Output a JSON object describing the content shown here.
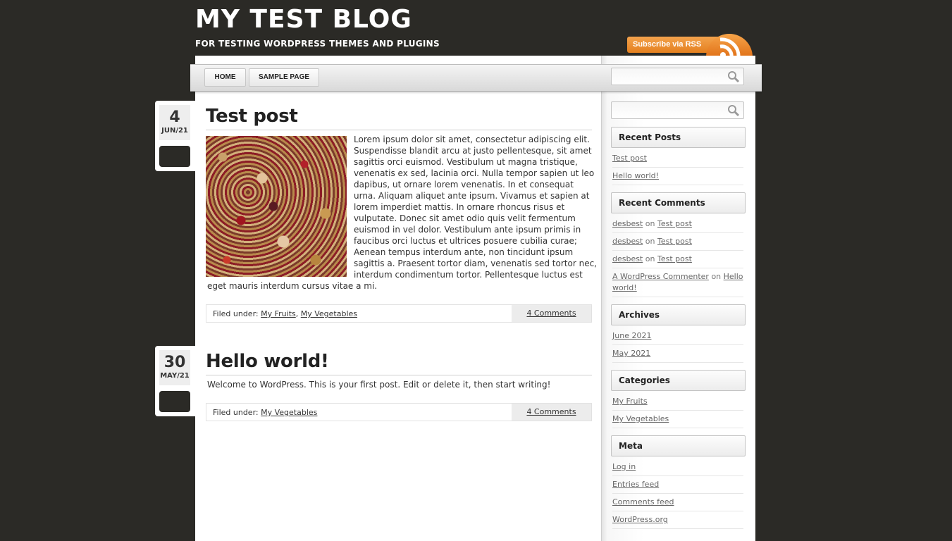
{
  "site": {
    "title": "MY TEST BLOG",
    "tagline": "FOR TESTING WORDPRESS THEMES AND PLUGINS",
    "rss_label": "Subscribe via RSS"
  },
  "nav": {
    "tabs": [
      {
        "label": "HOME"
      },
      {
        "label": "SAMPLE PAGE"
      }
    ],
    "search_placeholder": ""
  },
  "posts": [
    {
      "day": "4",
      "month": "JUN/21",
      "title": "Test post",
      "lines": [
        "Lorem ipsum dolor sit amet, consectetur adipiscing elit.",
        "Suspendisse blandit arcu at justo pellentesque, sit amet",
        "sagittis orci euismod. Vestibulum ut magna tristique,",
        "venenatis ex sed, lacinia orci. Nulla tempor sapien ut leo",
        "dapibus, ut ornare lorem venenatis. In et consequat",
        "urna. Aliquam aliquet ante ipsum. Vivamus et sapien at",
        "lorem imperdiet mattis. In ornare rhoncus risus et",
        "vulputate. Donec sit amet odio quis velit fermentum",
        "euismod in vel dolor. Vestibulum ante ipsum primis in",
        "faucibus orci luctus et ultrices posuere cubilia curae;",
        "Aenean tempus interdum ante, non tincidunt ipsum",
        "sagittis a. Praesent tortor diam, venenatis sed tortor nec,",
        "interdum condimentum tortor. Pellentesque luctus est"
      ],
      "last_line": "eget mauris interdum cursus vitae a mi.",
      "filed_label": "Filed under:",
      "categories": [
        "My Fruits",
        "My Vegetables"
      ],
      "comments": "4 Comments"
    },
    {
      "day": "30",
      "month": "MAY/21",
      "title": "Hello world!",
      "body": "Welcome to WordPress. This is your first post. Edit or delete it, then start writing!",
      "filed_label": "Filed under:",
      "categories": [
        "My Vegetables"
      ],
      "comments": "4 Comments"
    }
  ],
  "sidebar": {
    "search_placeholder": "",
    "recent_posts": {
      "title": "Recent Posts",
      "items": [
        "Test post",
        "Hello world!"
      ]
    },
    "recent_comments": {
      "title": "Recent Comments",
      "on": "on",
      "items": [
        {
          "author": "desbest",
          "post": "Test post"
        },
        {
          "author": "desbest",
          "post": "Test post"
        },
        {
          "author": "desbest",
          "post": "Test post"
        },
        {
          "author": "A WordPress Commenter",
          "post": "Hello world!"
        }
      ]
    },
    "archives": {
      "title": "Archives",
      "items": [
        "June 2021",
        "May 2021"
      ]
    },
    "categories": {
      "title": "Categories",
      "items": [
        "My Fruits",
        "My Vegetables"
      ]
    },
    "meta": {
      "title": "Meta",
      "items": [
        "Log in",
        "Entries feed",
        "Comments feed",
        "WordPress.org"
      ]
    }
  }
}
